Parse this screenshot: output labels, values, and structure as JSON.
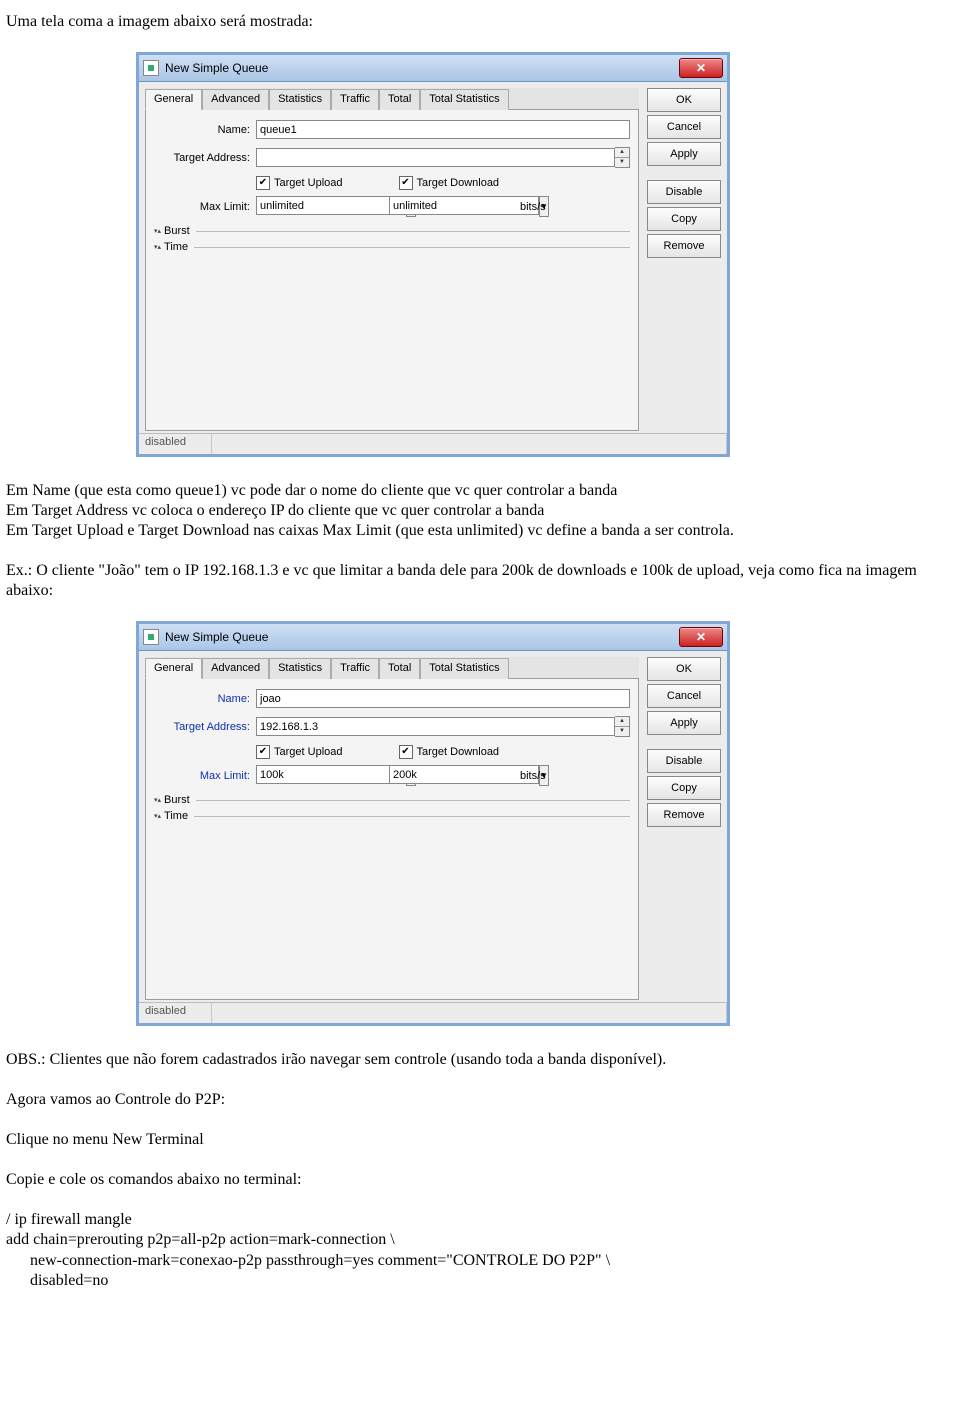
{
  "doc": {
    "intro": "Uma tela coma a imagem abaixo será mostrada:",
    "p1a": "Em Name (que esta como queue1) vc pode dar o nome do cliente que vc quer controlar a banda",
    "p1b": "Em Target Address vc coloca o endereço IP do cliente que vc quer controlar a banda",
    "p1c": "Em Target Upload e Target Download nas caixas Max Limit (que esta unlimited) vc define a banda a ser controla.",
    "p2": "Ex.: O cliente \"João\" tem o IP 192.168.1.3 e vc que limitar a banda dele para 200k de downloads e 100k de upload, veja como fica na imagem abaixo:",
    "obs": "OBS.: Clientes que não forem cadastrados irão navegar sem controle (usando toda a banda disponível).",
    "p3": "Agora vamos ao Controle do P2P:",
    "p4": "Clique no menu New Terminal",
    "p5": "Copie e cole os comandos abaixo no terminal:",
    "cmd1": "/ ip firewall mangle",
    "cmd2": "add chain=prerouting p2p=all-p2p action=mark-connection \\",
    "cmd3": "new-connection-mark=conexao-p2p passthrough=yes comment=\"CONTROLE DO P2P\" \\",
    "cmd4": "disabled=no"
  },
  "dialog": {
    "title": "New Simple Queue",
    "tabs": [
      "General",
      "Advanced",
      "Statistics",
      "Traffic",
      "Total",
      "Total Statistics"
    ],
    "labels": {
      "name": "Name:",
      "targetAddress": "Target Address:",
      "targetUpload": "Target Upload",
      "targetDownload": "Target Download",
      "maxLimit": "Max Limit:",
      "burst": "Burst",
      "time": "Time",
      "unit": "bits/s"
    },
    "buttons": {
      "ok": "OK",
      "cancel": "Cancel",
      "apply": "Apply",
      "disable": "Disable",
      "copy": "Copy",
      "remove": "Remove"
    },
    "status": "disabled"
  },
  "q1": {
    "name": "queue1",
    "targetAddress": "",
    "maxUp": "unlimited",
    "maxDown": "unlimited"
  },
  "q2": {
    "name": "joao",
    "targetAddress": "192.168.1.3",
    "maxUp": "100k",
    "maxDown": "200k"
  }
}
